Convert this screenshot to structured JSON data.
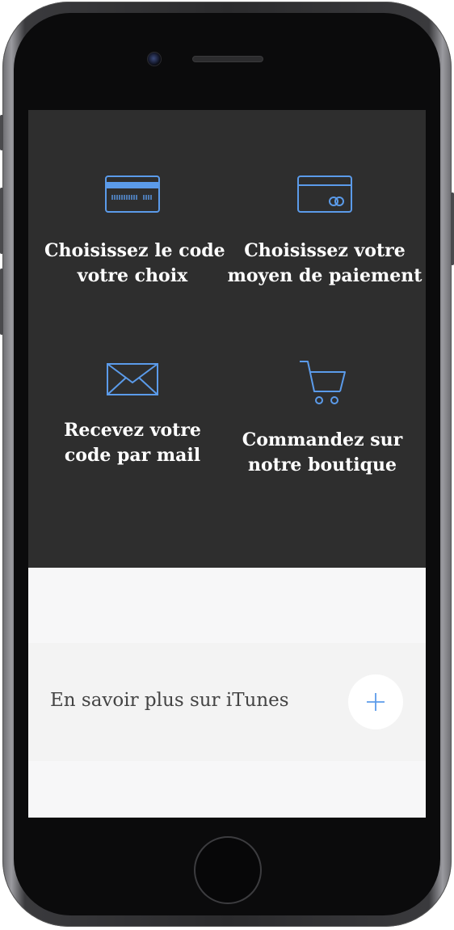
{
  "steps": [
    {
      "icon": "credit-card-icon",
      "label_line1": "Choisissez le code",
      "label_line2": "votre choix"
    },
    {
      "icon": "payment-card-icon",
      "label_line1": "Choisissez votre",
      "label_line2": "moyen de paiement"
    },
    {
      "icon": "envelope-icon",
      "label_line1": "Recevez votre",
      "label_line2": "code par mail"
    },
    {
      "icon": "shopping-cart-icon",
      "label_line1": "Commandez sur",
      "label_line2": "notre boutique"
    }
  ],
  "info": {
    "label": "En savoir plus sur iTunes",
    "button_icon": "plus-icon"
  },
  "colors": {
    "panel_background": "#2e2e2e",
    "icon_accent": "#5b9bea",
    "text_light": "#ffffff",
    "text_dark": "#444444",
    "info_background": "#f3f3f3"
  }
}
